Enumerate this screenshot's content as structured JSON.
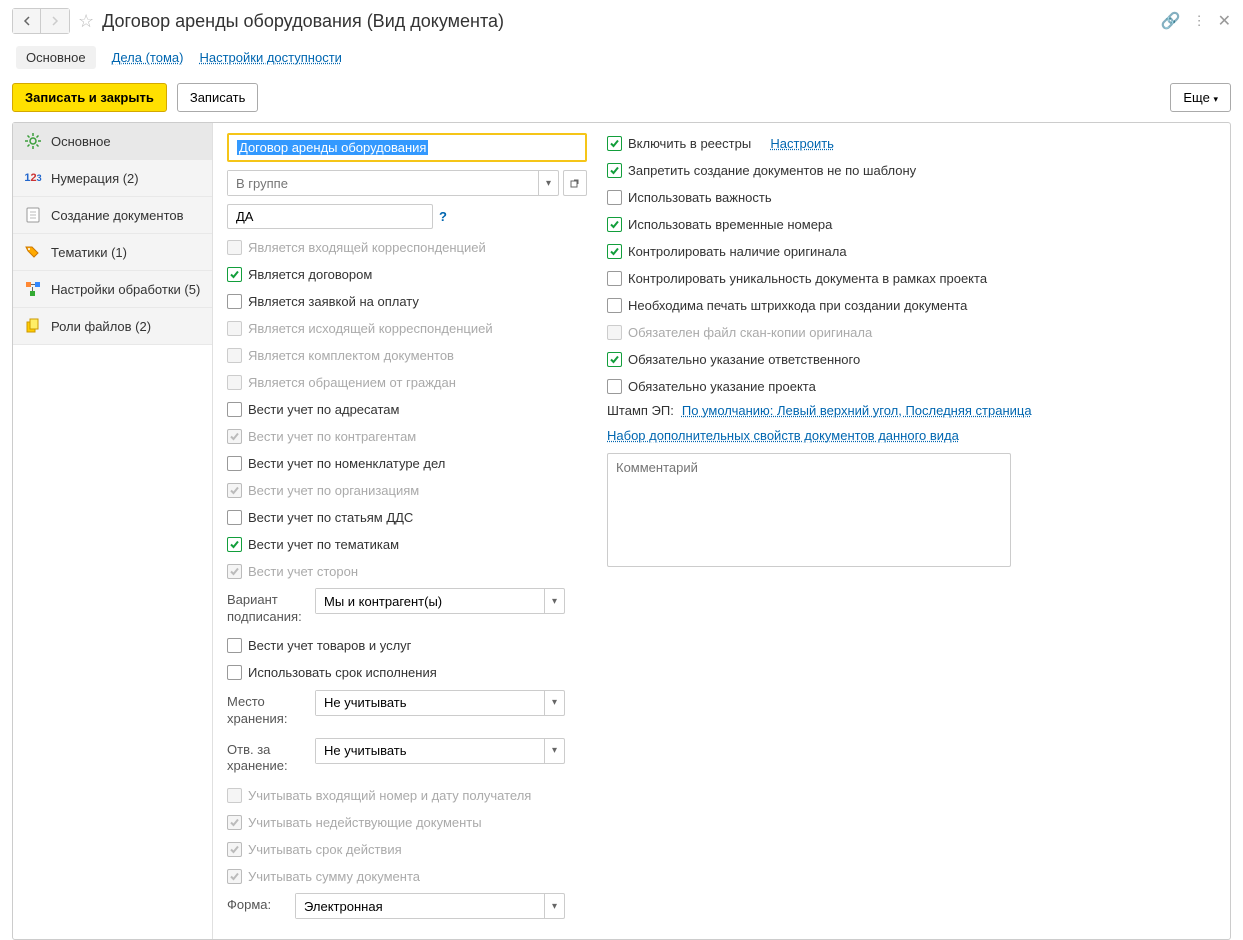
{
  "header": {
    "title": "Договор аренды оборудования (Вид документа)"
  },
  "tabs": {
    "main": "Основное",
    "cases": "Дела (тома)",
    "access": "Настройки доступности"
  },
  "toolbar": {
    "save_close": "Записать и закрыть",
    "save": "Записать",
    "more": "Еще"
  },
  "sidebar": {
    "main": "Основное",
    "numbering": "Нумерация (2)",
    "creation": "Создание документов",
    "themes": "Тематики (1)",
    "processing": "Настройки обработки (5)",
    "file_roles": "Роли файлов (2)"
  },
  "left": {
    "name_value": "Договор аренды оборудования",
    "group_placeholder": "В группе",
    "code_value": "ДА",
    "chk_incoming": "Является входящей корреспонденцией",
    "chk_contract": "Является договором",
    "chk_payment": "Является заявкой на оплату",
    "chk_outgoing": "Является исходящей корреспонденцией",
    "chk_docset": "Является комплектом документов",
    "chk_citizen": "Является обращением от граждан",
    "chk_addressees": "Вести учет по адресатам",
    "chk_counterparties": "Вести учет по контрагентам",
    "chk_nomenclature": "Вести учет по номенклатуре дел",
    "chk_orgs": "Вести учет по организациям",
    "chk_dds": "Вести учет по статьям ДДС",
    "chk_themes": "Вести учет по тематикам",
    "chk_parties": "Вести учет сторон",
    "signing_label": "Вариант подписания:",
    "signing_value": "Мы и контрагент(ы)",
    "chk_goods": "Вести учет товаров и услуг",
    "chk_deadline": "Использовать срок исполнения",
    "storage_label": "Место хранения:",
    "storage_value": "Не учитывать",
    "resp_label": "Отв. за хранение:",
    "resp_value": "Не учитывать",
    "chk_recipient_num": "Учитывать входящий номер и дату получателя",
    "chk_invalid": "Учитывать недействующие документы",
    "chk_validity": "Учитывать срок действия",
    "chk_amount": "Учитывать сумму документа",
    "form_label": "Форма:",
    "form_value": "Электронная"
  },
  "right": {
    "chk_registry": "Включить в реестры",
    "configure": "Настроить",
    "chk_template_only": "Запретить создание документов не по шаблону",
    "chk_importance": "Использовать важность",
    "chk_temp_numbers": "Использовать временные номера",
    "chk_original": "Контролировать наличие оригинала",
    "chk_unique": "Контролировать уникальность документа в рамках проекта",
    "chk_barcode": "Необходима печать штрихкода при создании документа",
    "chk_scan": "Обязателен файл скан-копии оригинала",
    "chk_responsible": "Обязательно указание ответственного",
    "chk_project": "Обязательно указание проекта",
    "stamp_label": "Штамп ЭП:",
    "stamp_value": "По умолчанию: Левый верхний угол, Последняя страница",
    "props_link": "Набор дополнительных свойств документов данного вида",
    "comment_placeholder": "Комментарий"
  }
}
